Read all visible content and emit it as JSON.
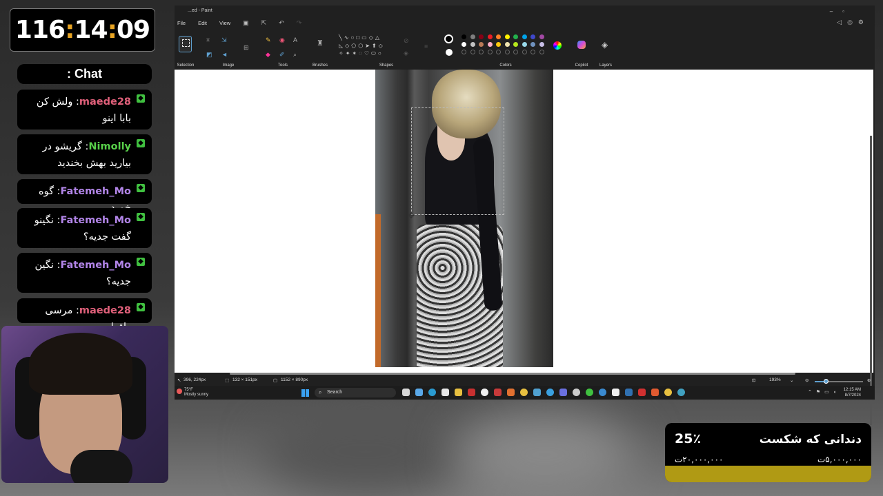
{
  "timer": {
    "hours": "116",
    "minutes": "14",
    "seconds": "09"
  },
  "chat": {
    "title": ": Chat",
    "messages": [
      {
        "user": "maede28",
        "color": "#e0607a",
        "text": "ولش کن بابا اینو"
      },
      {
        "user": "Nimolly",
        "color": "#58d04a",
        "text": "گریشو در بیارید بهش بخندید"
      },
      {
        "user": "Fatemeh_Mo",
        "color": "#b285e8",
        "text": "گوه خورد"
      },
      {
        "user": "Fatemeh_Mo",
        "color": "#b285e8",
        "text": "نگینو گفت جدیه؟"
      },
      {
        "user": "Fatemeh_Mo",
        "color": "#b285e8",
        "text": "نگین جدیه؟"
      },
      {
        "user": "maede28",
        "color": "#e0607a",
        "text": "مرسی واقعا"
      }
    ]
  },
  "paint": {
    "window_title": "...ed - Paint",
    "menu": {
      "file": "File",
      "edit": "Edit",
      "view": "View"
    },
    "groups": {
      "selection": "Selection",
      "image": "Image",
      "tools": "Tools",
      "brushes": "Brushes",
      "shapes": "Shapes",
      "colors": "Colors",
      "copilot": "Copilot",
      "layers": "Layers"
    },
    "palette_row1": [
      "#000000",
      "#7f7f7f",
      "#880015",
      "#ed1c24",
      "#ff7f27",
      "#fff200",
      "#22b14c",
      "#00a2e8",
      "#3f48cc",
      "#a349a4"
    ],
    "palette_row2": [
      "#ffffff",
      "#c3c3c3",
      "#b97a57",
      "#ffaec9",
      "#ffc90e",
      "#efe4b0",
      "#b5e61d",
      "#99d9ea",
      "#7092be",
      "#c8bfe7"
    ],
    "status": {
      "cursor_pos": "396, 224px",
      "selection_size": "132 × 151px",
      "image_size": "1152 × 890px",
      "zoom": "193%"
    },
    "zoom_level": 0.22
  },
  "taskbar": {
    "weather_temp": "75°F",
    "weather_desc": "Mostly sunny",
    "search_placeholder": "Search",
    "time": "12:15 AM",
    "date": "8/7/2024"
  },
  "donation": {
    "percent": "25٪",
    "title": "دندانی که شکست",
    "goal": "۲۰,۰۰۰,۰۰۰ت",
    "raised": "۵,۰۰۰,۰۰۰ت",
    "progress": 0.25
  }
}
